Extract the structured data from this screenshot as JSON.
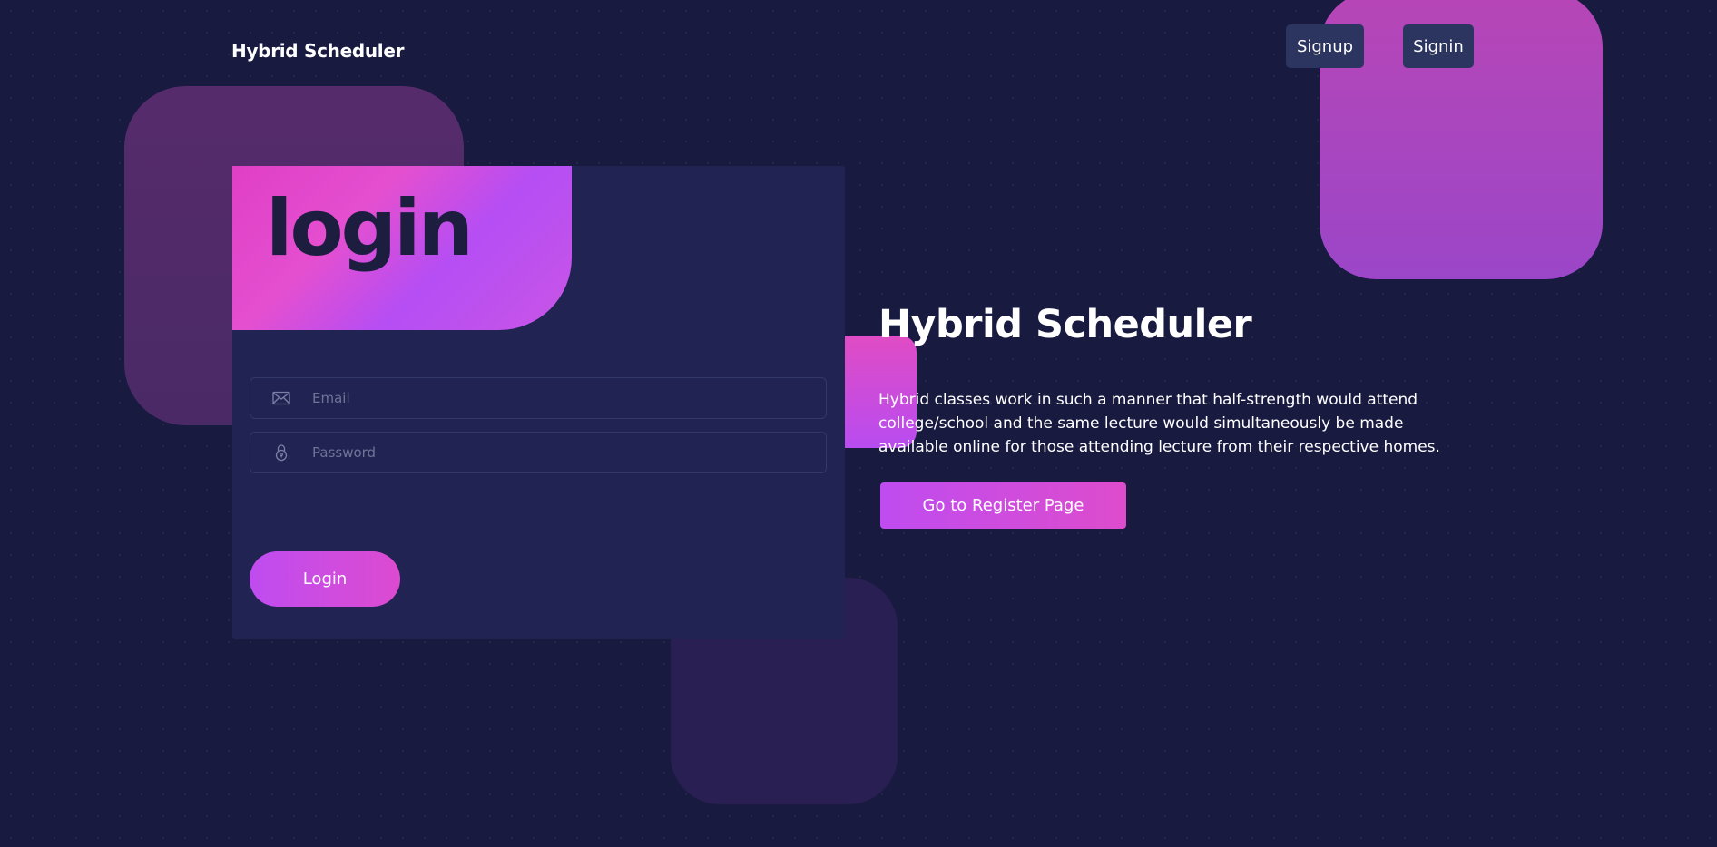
{
  "header": {
    "brand": "Hybrid Scheduler",
    "nav": {
      "signup_label": "Signup",
      "signin_label": "Signin"
    }
  },
  "login_card": {
    "title": "login",
    "email": {
      "icon": "mail-icon",
      "placeholder": "Email",
      "value": ""
    },
    "password": {
      "icon": "lock-icon",
      "placeholder": "Password",
      "value": ""
    },
    "submit_label": "Login"
  },
  "hero": {
    "title": "Hybrid Scheduler",
    "description": "Hybrid classes work in such a manner that half-strength would attend college/school and the same lecture would simultaneously be made available online for those attending lecture from their respective homes.",
    "cta_label": "Go to Register Page"
  },
  "colors": {
    "background": "#181a40",
    "card": "#212352",
    "accent_pink": "#e04cc4",
    "accent_purple": "#b84cf0",
    "nav_button": "#2c3460"
  }
}
